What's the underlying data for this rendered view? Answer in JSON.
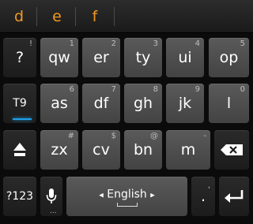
{
  "suggestions": [
    "d",
    "e",
    "f"
  ],
  "rows": [
    [
      {
        "label": "?",
        "hint": "!"
      },
      {
        "label": "qw",
        "hint": "1"
      },
      {
        "label": "er",
        "hint": "2"
      },
      {
        "label": "ty",
        "hint": "3"
      },
      {
        "label": "ui",
        "hint": "4"
      },
      {
        "label": "op",
        "hint": "5"
      }
    ],
    [
      {
        "label": "T9",
        "hint": ""
      },
      {
        "label": "as",
        "hint": "6"
      },
      {
        "label": "df",
        "hint": "7"
      },
      {
        "label": "gh",
        "hint": "8"
      },
      {
        "label": "jk",
        "hint": "9"
      },
      {
        "label": "l",
        "hint": "0"
      }
    ],
    [
      {
        "label": "zx",
        "hint": "#"
      },
      {
        "label": "cv",
        "hint": "$"
      },
      {
        "label": "bn",
        "hint": "@"
      },
      {
        "label": "m",
        "hint": "-"
      }
    ]
  ],
  "bottom": {
    "symbols_label": "?123",
    "mic_hint": "...",
    "space_label": "English",
    "lang_prev": "◂",
    "lang_next": "▸",
    "period_label": ".",
    "period_hint": ","
  },
  "colors": {
    "suggestion": "#f39a1e",
    "t9_indicator": "#1ea0e8"
  }
}
